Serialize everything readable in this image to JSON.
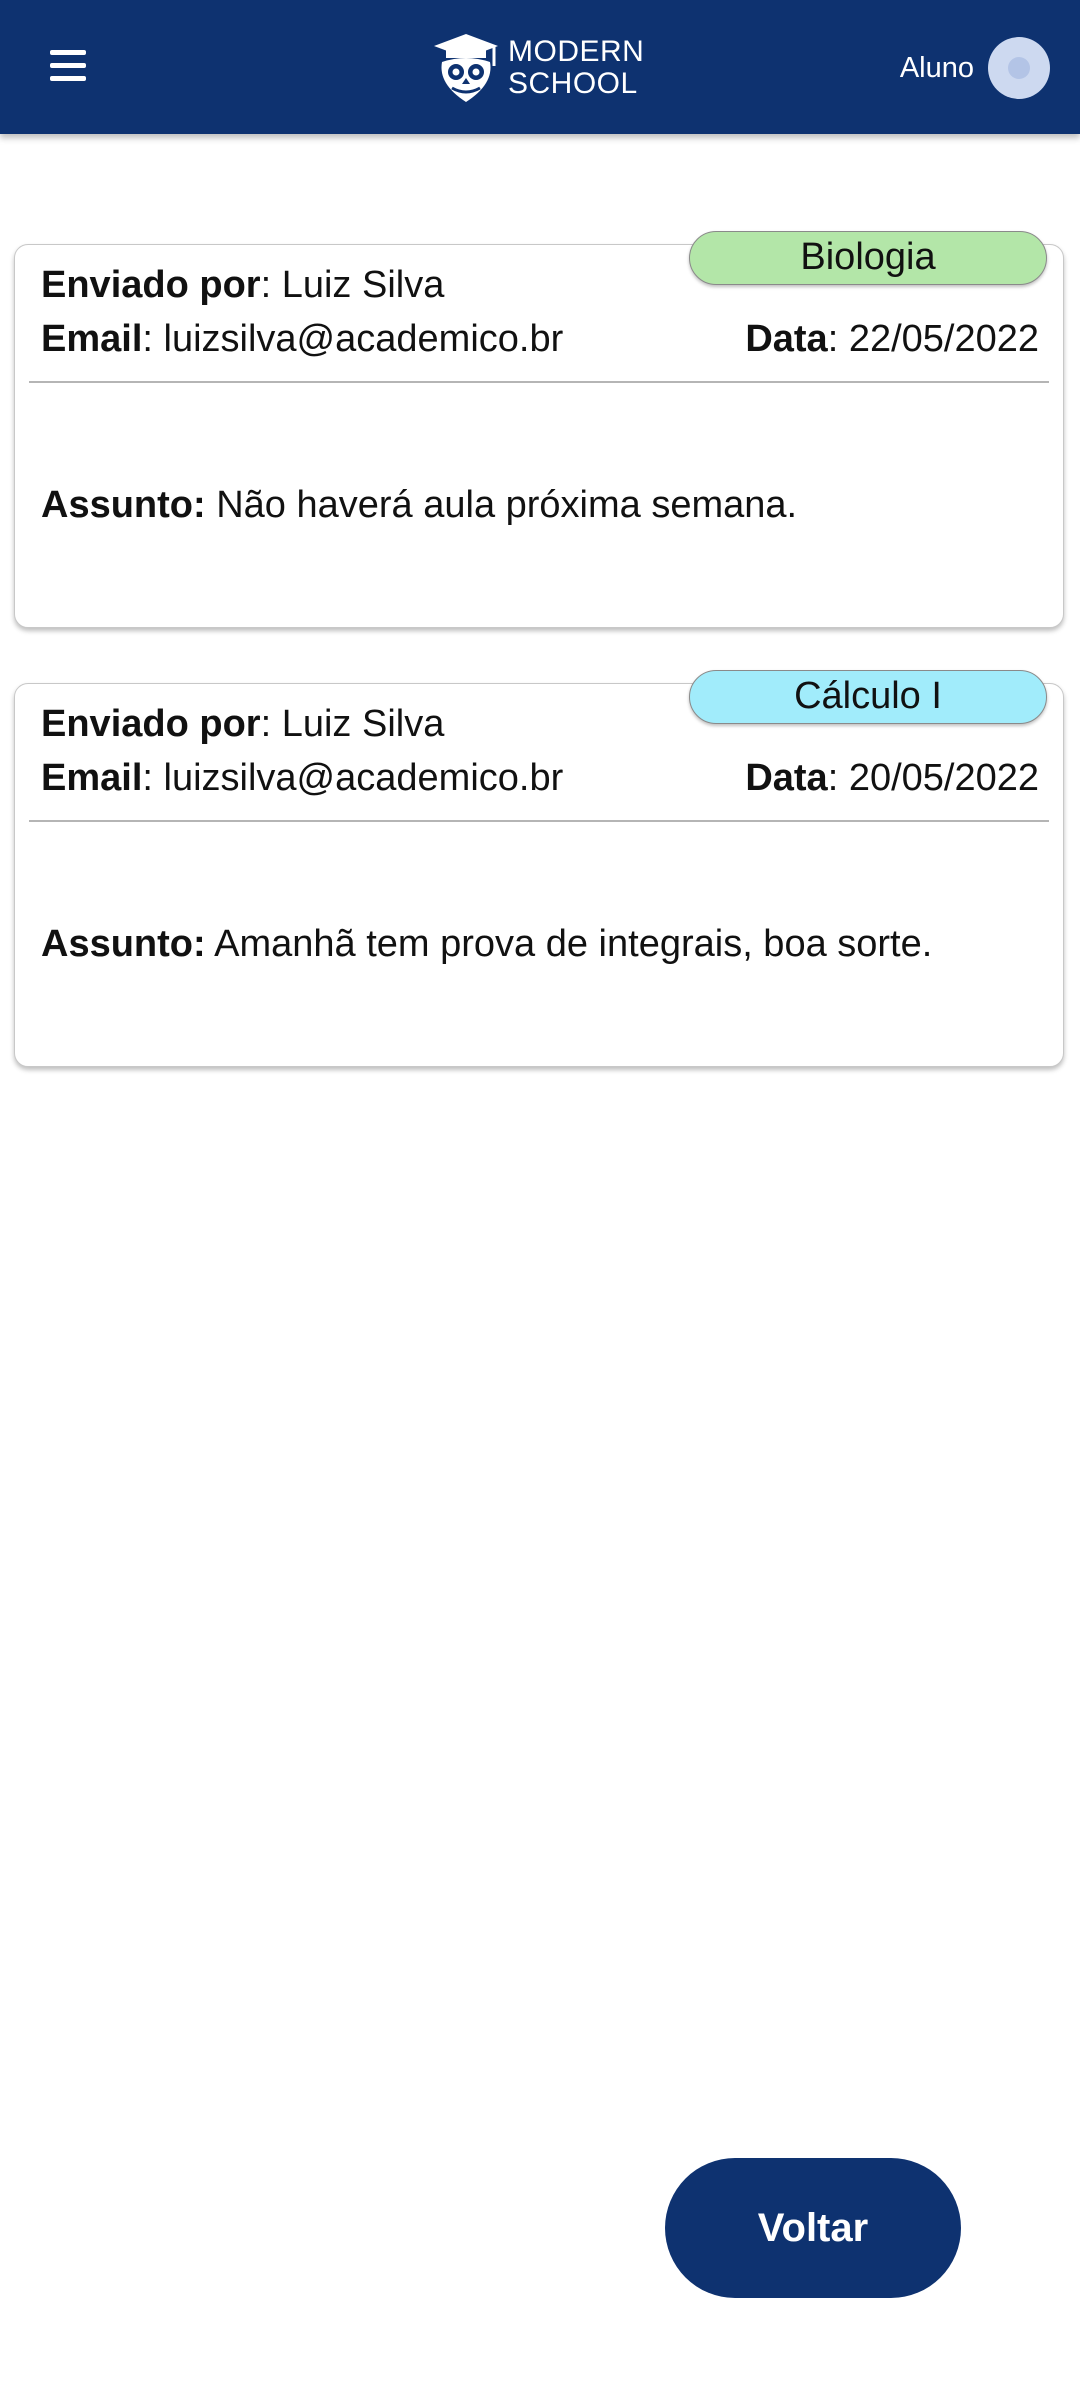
{
  "header": {
    "logo_line1": "MODERN",
    "logo_line2": "SCHOOL",
    "user_label": "Aluno"
  },
  "messages": [
    {
      "tag": "Biologia",
      "tag_color": "#b3e6a8",
      "sender_label": "Enviado por",
      "sender": "Luiz Silva",
      "email_label": "Email",
      "email": "luizsilva@academico.br",
      "date_label": "Data",
      "date": "22/05/2022",
      "subject_label": "Assunto:",
      "subject": "Não haverá aula próxima semana."
    },
    {
      "tag": "Cálculo I",
      "tag_color": "#a1ecfb",
      "sender_label": "Enviado por",
      "sender": "Luiz Silva",
      "email_label": "Email",
      "email": "luizsilva@academico.br",
      "date_label": "Data",
      "date": "20/05/2022",
      "subject_label": "Assunto:",
      "subject": "Amanhã tem prova de integrais, boa sorte."
    }
  ],
  "footer": {
    "back_label": "Voltar"
  },
  "colors": {
    "primary": "#0e3270"
  },
  "icons": {
    "menu": "hamburger-menu-icon",
    "logo": "owl-graduation-cap-icon",
    "avatar": "user-avatar-icon"
  }
}
